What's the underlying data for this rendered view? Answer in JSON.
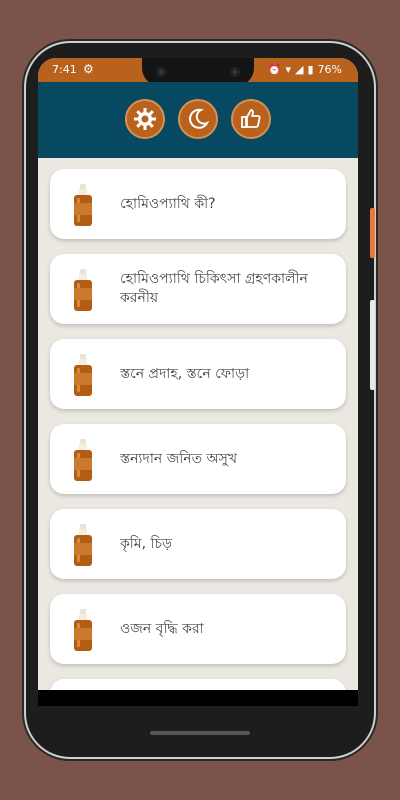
{
  "status": {
    "time": "7:41",
    "battery": "76%"
  },
  "header": {
    "buttons": [
      {
        "name": "settings",
        "icon": "gear-icon"
      },
      {
        "name": "night-mode",
        "icon": "moon-icon"
      },
      {
        "name": "like",
        "icon": "thumbs-up-icon"
      }
    ]
  },
  "colors": {
    "accent": "#b8621d",
    "header_bg": "#074960",
    "list_bg": "#eae8e0"
  },
  "items": [
    {
      "label": "হোমিওপ্যাথি কী?"
    },
    {
      "label": "হোমিওপ্যাথি চিকিৎসা গ্রহণকালীন করনীয়"
    },
    {
      "label": "স্তনে প্রদাহ, স্তনে ফোড়া"
    },
    {
      "label": "স্তন্যদান জনিত অসুখ"
    },
    {
      "label": "কৃমি, চিড়"
    },
    {
      "label": "ওজন বৃদ্ধি করা"
    }
  ]
}
